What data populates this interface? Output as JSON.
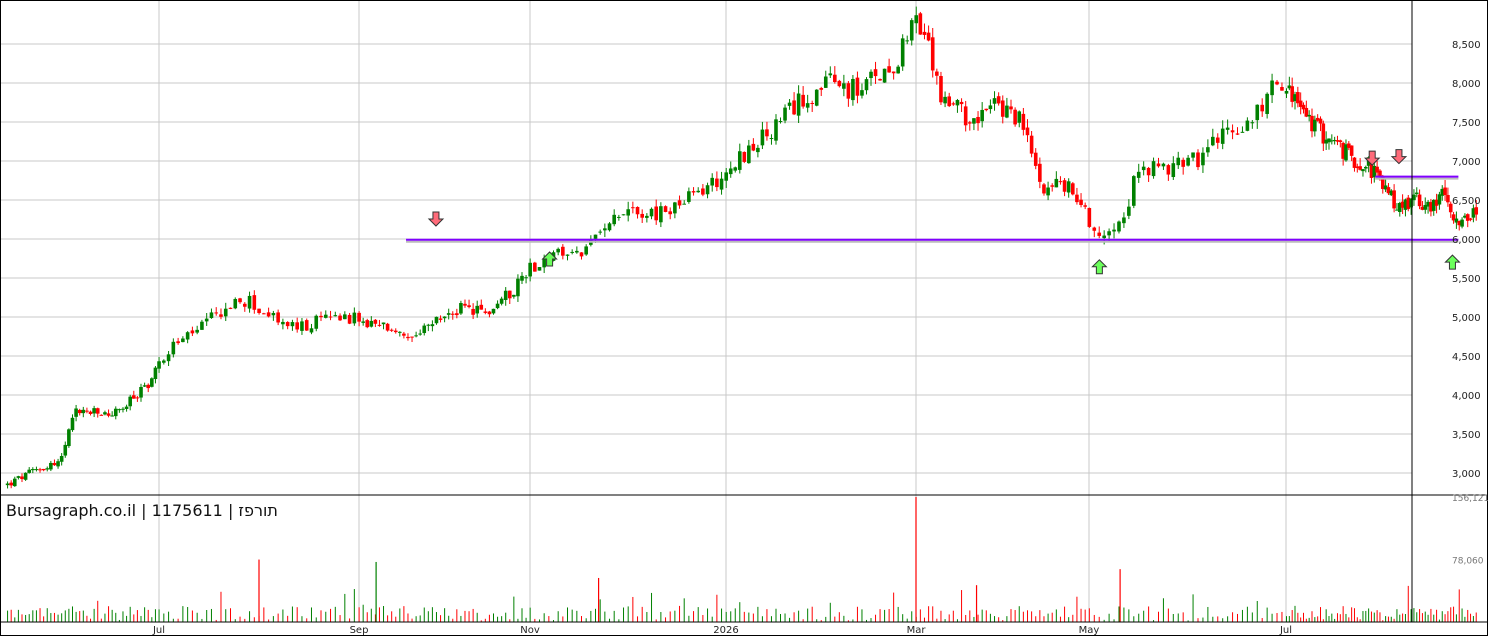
{
  "chart_data": {
    "type": "candlestick",
    "title": "Bursagraph.co.il | 1175611 | תורפז",
    "price_axis": {
      "ticks": [
        "3,000",
        "3,500",
        "4,000",
        "4,500",
        "5,000",
        "5,500",
        "6,000",
        "6,500",
        "7,000",
        "7,500",
        "8,000",
        "8,500"
      ],
      "tick_values": [
        3000,
        3500,
        4000,
        4500,
        5000,
        5500,
        6000,
        6500,
        7000,
        7500,
        8000,
        8500
      ],
      "ylim": [
        2700,
        9000
      ]
    },
    "volume_axis": {
      "ticks": [
        "156,121",
        "78,060"
      ],
      "tick_values": [
        156121,
        78060
      ]
    },
    "x_ticks": [
      "Jul",
      "Sep",
      "Nov",
      "2026",
      "Mar",
      "May",
      "Jul"
    ],
    "grid": true,
    "colors": {
      "up": "#008000",
      "down": "#ff0000",
      "level_lines": "#8000ff",
      "down_arrow": "#ff6b7a",
      "up_arrow": "#6cff5c",
      "grid": "#c8c8c8",
      "axis": "#000000"
    },
    "horizontal_levels": [
      {
        "value": 5990,
        "from_month": 4.55,
        "to_month": 16.8
      },
      {
        "value": 6800,
        "from_month": 15.4,
        "to_month": 16.8
      }
    ],
    "signals": [
      {
        "type": "down",
        "month": 4.9,
        "price": 6000
      },
      {
        "type": "up",
        "month": 6.2,
        "price": 6000
      },
      {
        "type": "up",
        "month": 12.1,
        "price": 5900
      },
      {
        "type": "down",
        "month": 15.35,
        "price": 6780
      },
      {
        "type": "down",
        "month": 15.8,
        "price": 6800
      },
      {
        "type": "up",
        "month": 16.7,
        "price": 5960
      }
    ],
    "price_path": [
      [
        0.0,
        2850
      ],
      [
        0.4,
        3050
      ],
      [
        0.7,
        3150
      ],
      [
        0.9,
        3800
      ],
      [
        1.3,
        3750
      ],
      [
        1.5,
        3800
      ],
      [
        1.9,
        4200
      ],
      [
        2.1,
        4600
      ],
      [
        2.4,
        4850
      ],
      [
        2.7,
        5150
      ],
      [
        2.9,
        5200
      ],
      [
        3.1,
        5000
      ],
      [
        3.4,
        4850
      ],
      [
        3.8,
        5050
      ],
      [
        4.1,
        4900
      ],
      [
        4.4,
        4850
      ],
      [
        4.6,
        4650
      ],
      [
        4.9,
        4950
      ],
      [
        5.2,
        5100
      ],
      [
        5.5,
        5050
      ],
      [
        5.8,
        5350
      ],
      [
        6.0,
        5650
      ],
      [
        6.3,
        5800
      ],
      [
        6.6,
        5850
      ],
      [
        6.8,
        6300
      ],
      [
        7.0,
        6400
      ],
      [
        7.3,
        6300
      ],
      [
        7.6,
        6500
      ],
      [
        7.9,
        6750
      ],
      [
        8.2,
        7100
      ],
      [
        8.5,
        7400
      ],
      [
        8.8,
        7800
      ],
      [
        9.1,
        8000
      ],
      [
        9.4,
        7900
      ],
      [
        9.6,
        8100
      ],
      [
        9.8,
        8300
      ],
      [
        9.95,
        8850
      ],
      [
        10.1,
        8600
      ],
      [
        10.3,
        7800
      ],
      [
        10.6,
        7550
      ],
      [
        10.9,
        7700
      ],
      [
        11.2,
        7550
      ],
      [
        11.45,
        6700
      ],
      [
        11.7,
        6700
      ],
      [
        11.9,
        6500
      ],
      [
        12.1,
        6000
      ],
      [
        12.35,
        6400
      ],
      [
        12.5,
        6950
      ],
      [
        12.7,
        6850
      ],
      [
        12.9,
        7000
      ],
      [
        13.1,
        7050
      ],
      [
        13.3,
        7350
      ],
      [
        13.6,
        7550
      ],
      [
        13.75,
        8000
      ],
      [
        13.95,
        7900
      ],
      [
        14.3,
        7500
      ],
      [
        14.6,
        7300
      ],
      [
        14.9,
        7100
      ],
      [
        15.1,
        7000
      ],
      [
        15.3,
        6950
      ],
      [
        15.5,
        6700
      ],
      [
        15.8,
        6400
      ],
      [
        16.0,
        6500
      ],
      [
        16.3,
        6450
      ],
      [
        16.55,
        6550
      ],
      [
        16.8,
        6250
      ],
      [
        17.0,
        6200
      ],
      [
        17.1,
        6400
      ]
    ],
    "volume_spikes": [
      {
        "month": 3.0,
        "value": 78000,
        "dir": "down"
      },
      {
        "month": 4.2,
        "value": 75000,
        "dir": "up"
      },
      {
        "month": 6.7,
        "value": 55000,
        "dir": "down"
      },
      {
        "month": 10.0,
        "value": 156121,
        "dir": "down"
      },
      {
        "month": 10.7,
        "value": 46000,
        "dir": "down"
      },
      {
        "month": 12.3,
        "value": 66000,
        "dir": "down"
      }
    ]
  }
}
